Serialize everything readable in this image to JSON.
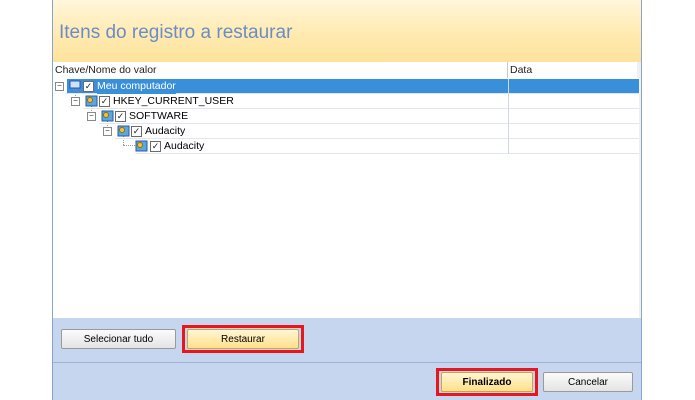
{
  "header": {
    "title": "Itens do registro a restaurar"
  },
  "columns": {
    "name": "Chave/Nome do valor",
    "data": "Data"
  },
  "tree": [
    {
      "label": "Meu computador",
      "checked": true,
      "selected": true,
      "icon": "computer-icon"
    },
    {
      "label": "HKEY_CURRENT_USER",
      "checked": true,
      "icon": "registry-key-icon"
    },
    {
      "label": "SOFTWARE",
      "checked": true,
      "icon": "registry-key-icon"
    },
    {
      "label": "Audacity",
      "checked": true,
      "icon": "registry-key-icon"
    },
    {
      "label": "Audacity",
      "checked": true,
      "icon": "registry-key-icon"
    }
  ],
  "buttons": {
    "select_all": "Selecionar tudo",
    "restore": "Restaurar",
    "finish": "Finalizado",
    "cancel": "Cancelar"
  },
  "colors": {
    "highlight": "#e8161d",
    "selection": "#3a8fd9",
    "title": "#6b8cc9"
  }
}
